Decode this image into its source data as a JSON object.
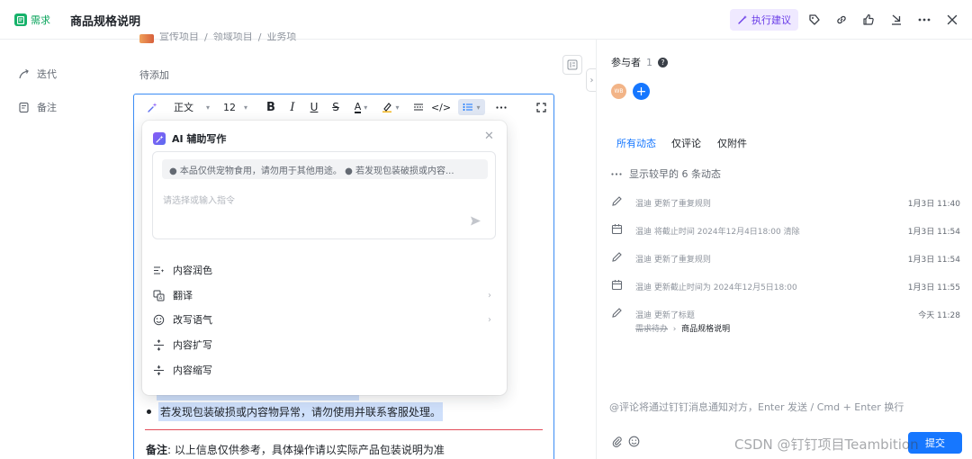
{
  "header": {
    "type_badge": "需求",
    "title": "商品规格说明",
    "exec_suggestion": "执行建议",
    "icons": [
      "tag-icon",
      "link-icon",
      "thumbs-up-icon",
      "download-icon",
      "more-icon",
      "close-icon"
    ]
  },
  "fields": {
    "breadcrumb": [
      "宣传项目",
      "领域项目",
      "业务项"
    ],
    "iteration_label": "迭代",
    "iteration_value": "待添加",
    "notes_label": "备注"
  },
  "toolbar": {
    "text_style": "正文",
    "font_size": "12"
  },
  "ai_popup": {
    "title": "AI 辅助写作",
    "context_text": "● 本品仅供宠物食用，请勿用于其他用途。 ● 若发现包装破损或内容...",
    "input_placeholder": "请选择或输入指令",
    "menu": [
      {
        "label": "内容润色",
        "icon": "polish-icon",
        "has_submenu": false
      },
      {
        "label": "翻译",
        "icon": "translate-icon",
        "has_submenu": true
      },
      {
        "label": "改写语气",
        "icon": "tone-icon",
        "has_submenu": true
      },
      {
        "label": "内容扩写",
        "icon": "expand-icon",
        "has_submenu": false
      },
      {
        "label": "内容缩写",
        "icon": "shrink-icon",
        "has_submenu": false
      }
    ]
  },
  "editor": {
    "bullet_text": "若发现包装破损或内容物异常，请勿使用并联系客服处理。",
    "note_label": "备注",
    "note_text": ": 以上信息仅供参考，具体操作请以实际产品包装说明为准"
  },
  "right_panel": {
    "participants_label": "参与者",
    "participants_count": "1",
    "avatar_text": "WB",
    "tabs": [
      "所有动态",
      "仅评论",
      "仅附件"
    ],
    "active_tab": "所有动态",
    "show_earlier": "显示较早的 6 条动态",
    "activities": [
      {
        "icon": "edit-icon",
        "text": "温迪 更新了重复规则",
        "time": "1月3日 11:40"
      },
      {
        "icon": "calendar-icon",
        "text": "温迪 将截止时间 2024年12月4日18:00 清除",
        "time": "1月3日 11:54"
      },
      {
        "icon": "edit-icon",
        "text": "温迪 更新了重复规则",
        "time": "1月3日 11:54"
      },
      {
        "icon": "calendar-icon",
        "text": "温迪 更新截止时间为 2024年12月5日18:00",
        "time": "1月3日 11:55"
      },
      {
        "icon": "edit-icon",
        "text": "温迪 更新了标题",
        "time": "今天 11:28",
        "old": "需求待办",
        "new": "商品规格说明"
      }
    ],
    "comment_placeholder": "@评论将通过钉钉消息通知对方，Enter 发送 / Cmd + Enter 换行",
    "submit_label": "提交"
  },
  "watermark": "CSDN @钉钉项目Teambition",
  "colors": {
    "accent": "#1677ff",
    "brand_green": "#16b26a",
    "ai_purple": "#6a3de8",
    "editor_border": "#3b8cf4"
  }
}
